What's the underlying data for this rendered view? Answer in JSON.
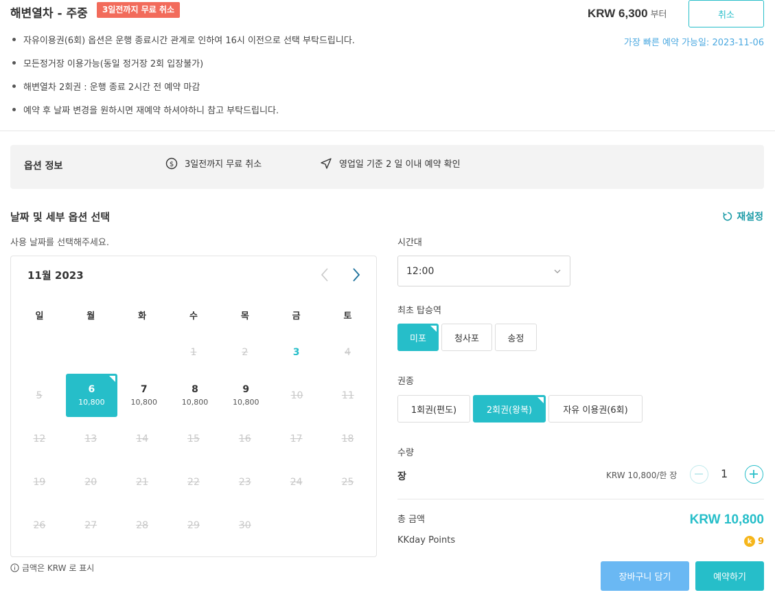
{
  "header": {
    "title": "해변열차 - 주중",
    "badge": "3일전까지 무료 취소",
    "price": "KRW 6,300",
    "price_suffix": "부터",
    "cancel_label": "취소",
    "earliest": "가장 빠른 예약 가능일: 2023-11-06"
  },
  "notes": [
    "자유이용권(6회) 옵션은 운행 종료시간 관계로 인하여 16시 이전으로 선택 부탁드립니다.",
    "모든정거장 이용가능(동일 정거장 2회 입장불가)",
    "해변열차 2회권 : 운행 종료 2시간 전 예약 마감",
    "예약 후 날짜 변경을 원하시면 재예약 하셔야하니 참고 부탁드립니다."
  ],
  "option_info": {
    "title": "옵션 정보",
    "free_cancel": "3일전까지 무료 취소",
    "confirm": "영업일 기준 2 일 이내 예약 확인"
  },
  "section": {
    "title": "날짜 및 세부 옵션 선택",
    "reset": "재설정",
    "date_hint": "사용 날짜를 선택해주세요.",
    "krw_note": "금액은 KRW 로 표시"
  },
  "calendar": {
    "month": "11월 2023",
    "weekdays": [
      "일",
      "월",
      "화",
      "수",
      "목",
      "금",
      "토"
    ],
    "rows": [
      [
        {
          "d": "",
          "s": "empty"
        },
        {
          "d": "",
          "s": "empty"
        },
        {
          "d": "",
          "s": "empty"
        },
        {
          "d": "1",
          "s": "disabled"
        },
        {
          "d": "2",
          "s": "disabled"
        },
        {
          "d": "3",
          "s": "special"
        },
        {
          "d": "4",
          "s": "disabled"
        }
      ],
      [
        {
          "d": "5",
          "s": "disabled"
        },
        {
          "d": "6",
          "s": "selected",
          "p": "10,800"
        },
        {
          "d": "7",
          "s": "available",
          "p": "10,800"
        },
        {
          "d": "8",
          "s": "available",
          "p": "10,800"
        },
        {
          "d": "9",
          "s": "available",
          "p": "10,800"
        },
        {
          "d": "10",
          "s": "disabled"
        },
        {
          "d": "11",
          "s": "disabled"
        }
      ],
      [
        {
          "d": "12",
          "s": "disabled"
        },
        {
          "d": "13",
          "s": "disabled"
        },
        {
          "d": "14",
          "s": "disabled"
        },
        {
          "d": "15",
          "s": "disabled"
        },
        {
          "d": "16",
          "s": "disabled"
        },
        {
          "d": "17",
          "s": "disabled"
        },
        {
          "d": "18",
          "s": "disabled"
        }
      ],
      [
        {
          "d": "19",
          "s": "disabled"
        },
        {
          "d": "20",
          "s": "disabled"
        },
        {
          "d": "21",
          "s": "disabled"
        },
        {
          "d": "22",
          "s": "disabled"
        },
        {
          "d": "23",
          "s": "disabled"
        },
        {
          "d": "24",
          "s": "disabled"
        },
        {
          "d": "25",
          "s": "disabled"
        }
      ],
      [
        {
          "d": "26",
          "s": "disabled"
        },
        {
          "d": "27",
          "s": "disabled"
        },
        {
          "d": "28",
          "s": "disabled"
        },
        {
          "d": "29",
          "s": "disabled"
        },
        {
          "d": "30",
          "s": "disabled"
        },
        {
          "d": "",
          "s": "empty"
        },
        {
          "d": "",
          "s": "empty"
        }
      ]
    ]
  },
  "time": {
    "label": "시간대",
    "value": "12:00"
  },
  "station": {
    "label": "최초 탑승역",
    "options": [
      "미포",
      "청사포",
      "송정"
    ],
    "selected": 0
  },
  "ticket": {
    "label": "권종",
    "options": [
      "1회권(편도)",
      "2회권(왕복)",
      "자유 이용권(6회)"
    ],
    "selected": 1
  },
  "quantity": {
    "label": "수량",
    "unit_label": "장",
    "unit_price": "KRW 10,800/한 장",
    "value": "1"
  },
  "totals": {
    "total_label": "총 금액",
    "total_value": "KRW 10,800",
    "points_label": "KKday Points",
    "points_icon": "k",
    "points_value": "9"
  },
  "actions": {
    "cart": "장바구니 담기",
    "book": "예약하기"
  },
  "colors": {
    "accent": "#26bec9",
    "badge": "#f26b5b",
    "cart": "#6ab8f3"
  }
}
